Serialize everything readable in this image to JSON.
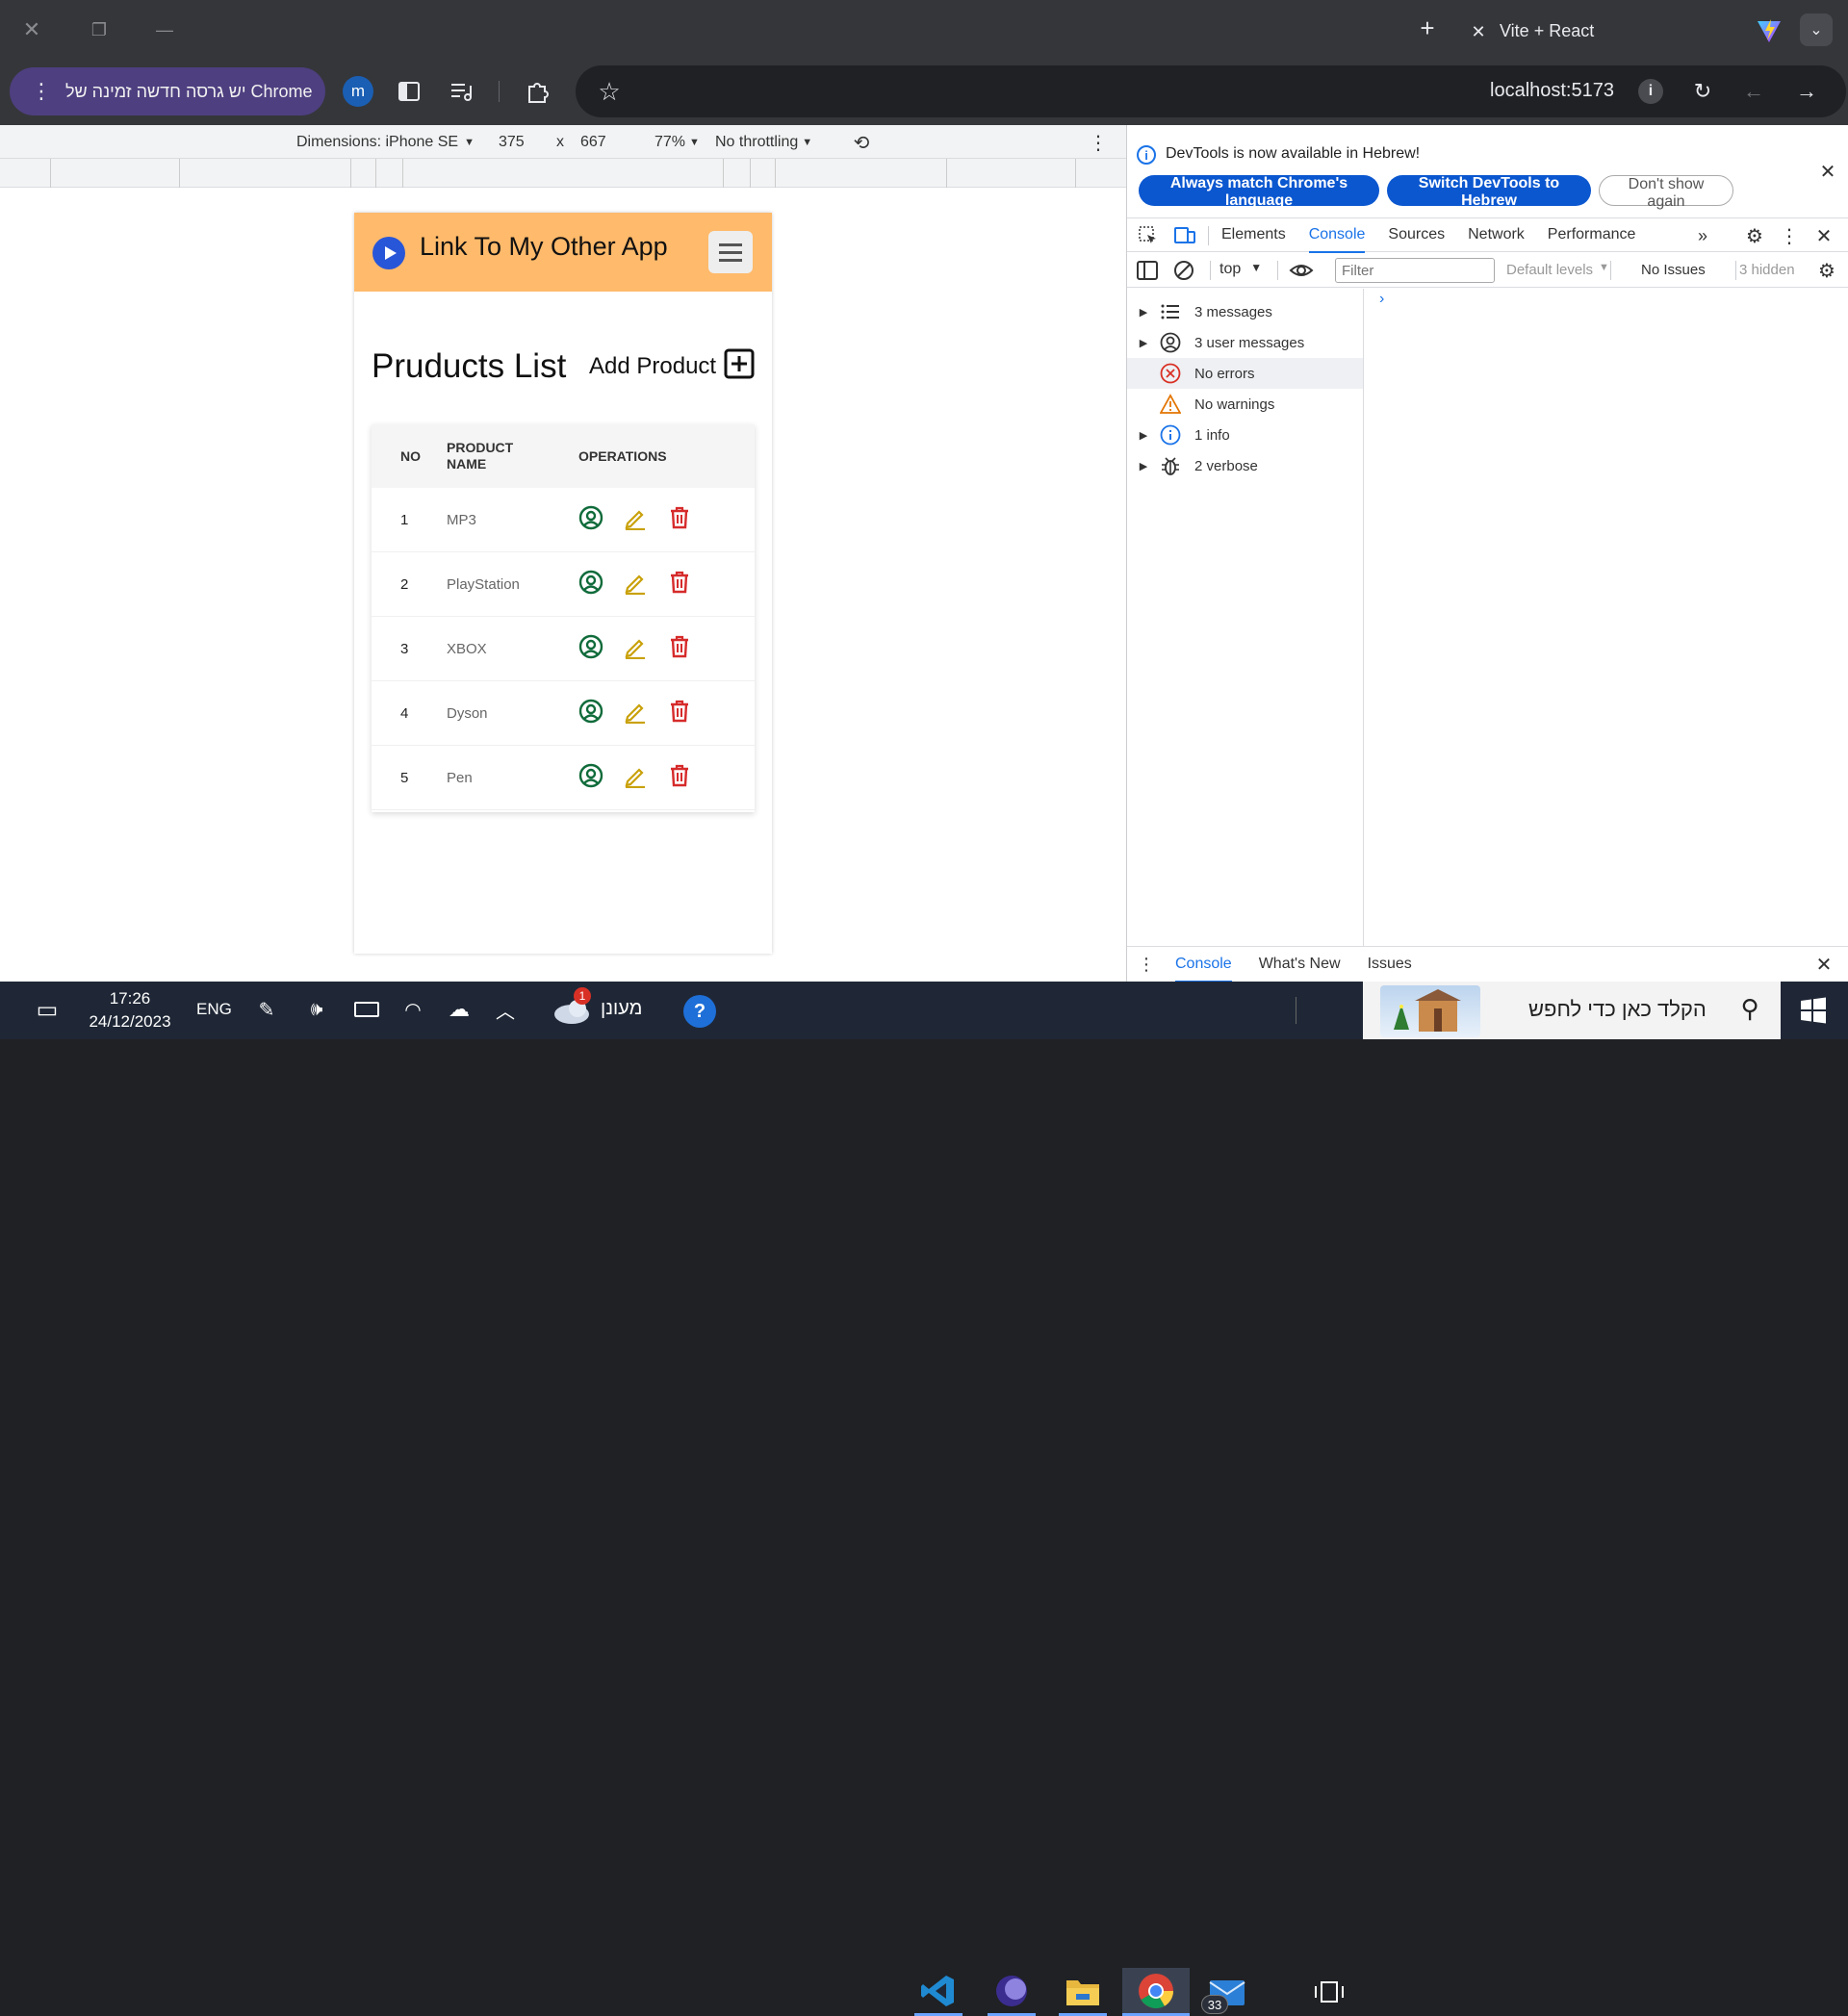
{
  "browser": {
    "tab_title": "Vite + React",
    "update_chip": "יש גרסה חדשה זמינה של Chrome",
    "profile_initial": "m",
    "url": "localhost:5173"
  },
  "device_toolbar": {
    "dimensions_label": "Dimensions: iPhone SE",
    "width": "375",
    "times": "x",
    "height": "667",
    "zoom": "77%",
    "throttling": "No throttling"
  },
  "app": {
    "header_title": "Link To My Other App",
    "page_title": "Pruducts List",
    "add_product_label": "Add Product",
    "columns": [
      "NO",
      "PRODUCT NAME",
      "OPERATIONS"
    ],
    "products": [
      {
        "no": "1",
        "name": "MP3"
      },
      {
        "no": "2",
        "name": "PlayStation"
      },
      {
        "no": "3",
        "name": "XBOX"
      },
      {
        "no": "4",
        "name": "Dyson"
      },
      {
        "no": "5",
        "name": "Pen"
      }
    ],
    "colors": {
      "header_bg": "#ffba6b",
      "view": "#0f6b3a",
      "edit": "#c9a10a",
      "delete": "#d62b2b"
    }
  },
  "devtools": {
    "banner_text": "DevTools is now available in Hebrew!",
    "btn_match": "Always match Chrome's language",
    "btn_switch": "Switch DevTools to Hebrew",
    "btn_dont_show": "Don't show again",
    "tabs": [
      "Elements",
      "Console",
      "Sources",
      "Network",
      "Performance"
    ],
    "active_tab": "Console",
    "context": "top",
    "filter_placeholder": "Filter",
    "levels": "Default levels",
    "issues": "No Issues",
    "hidden": "3 hidden",
    "sidebar": [
      {
        "label": "3 messages",
        "icon": "list-icon"
      },
      {
        "label": "3 user messages",
        "icon": "user-icon"
      },
      {
        "label": "No errors",
        "icon": "error-icon"
      },
      {
        "label": "No warnings",
        "icon": "warning-icon"
      },
      {
        "label": "1 info",
        "icon": "info-icon"
      },
      {
        "label": "2 verbose",
        "icon": "bug-icon"
      }
    ],
    "drawer_tabs": [
      "Console",
      "What's New",
      "Issues"
    ]
  },
  "taskbar": {
    "time": "17:26",
    "date": "24/12/2023",
    "lang": "ENG",
    "weather": "מעונן",
    "search_placeholder": "הקלד כאן כדי לחפש",
    "weather_badge": "1",
    "app_badge": "33"
  }
}
